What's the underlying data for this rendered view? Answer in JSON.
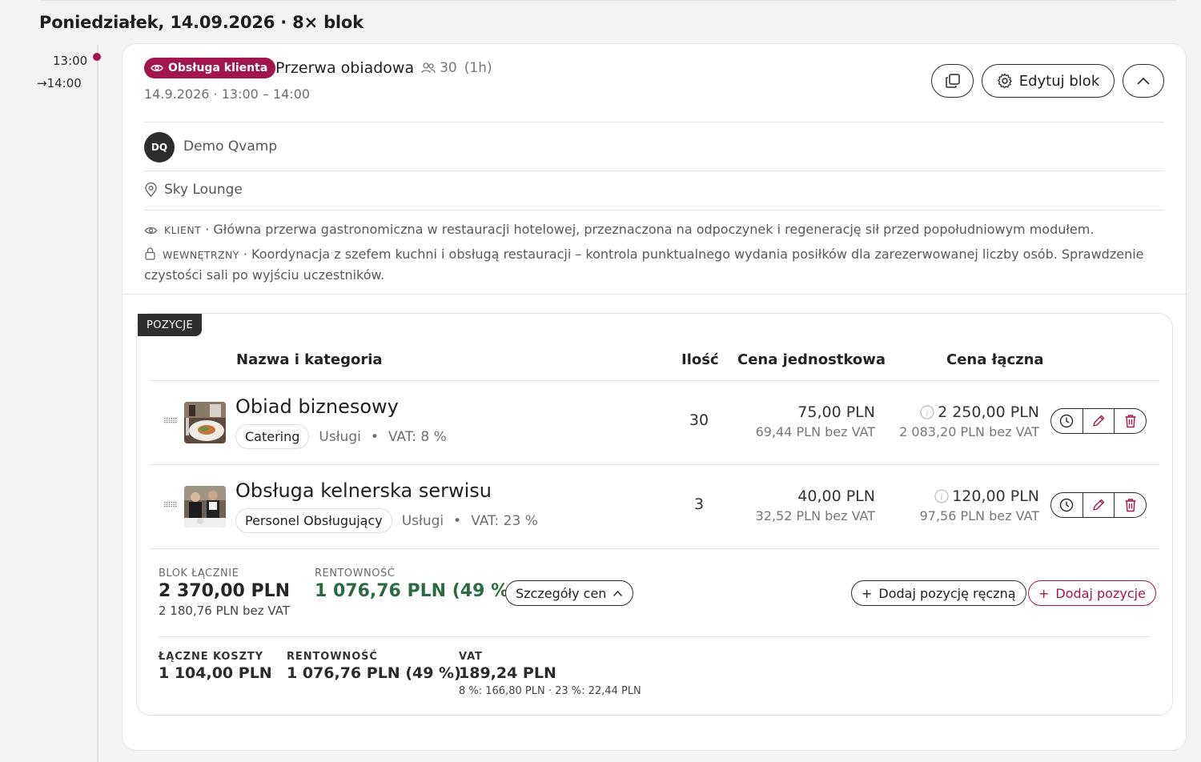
{
  "day_header": "Poniedziałek, 14.09.2026 · 8× blok",
  "timeline": {
    "start": "13:00",
    "end": "→14:00"
  },
  "block": {
    "badge": "Obsługa klienta",
    "title": "Przerwa obiadowa",
    "participants": "30",
    "duration": "(1h)",
    "datetime": "14.9.2026 · 13:00 – 14:00",
    "edit_label": "Edytuj blok",
    "client_initials": "DQ",
    "client_name": "Demo Qvamp",
    "venue": "Sky Lounge",
    "note_client_tag": "KLIENT",
    "note_client_text": " · Główna przerwa gastronomiczna w restauracji hotelowej, przeznaczona na odpoczynek i regenerację sił przed popołudniowym modułem.",
    "note_internal_tag": "WEWNĘTRZNY",
    "note_internal_text": " · Koordynacja z szefem kuchni i obsługą restauracji – kontrola punktualnego wydania posiłków dla zarezerwowanej liczby osób. Sprawdzenie czystości sali po wyjściu uczestników."
  },
  "positions": {
    "tag": "POZYCJE",
    "headers": {
      "name": "Nazwa i kategoria",
      "qty": "Ilość",
      "unit_price": "Cena jednostkowa",
      "total_price": "Cena łączna"
    },
    "items": [
      {
        "name": "Obiad biznesowy",
        "category": "Catering",
        "type": "Usługi",
        "vat": "VAT: 8 %",
        "qty": "30",
        "unit_gross": "75,00 PLN",
        "unit_net": "69,44 PLN bez VAT",
        "total_gross": "2 250,00 PLN",
        "total_net": "2 083,20 PLN bez VAT"
      },
      {
        "name": "Obsługa kelnerska serwisu",
        "category": "Personel Obsługujący",
        "type": "Usługi",
        "vat": "VAT: 23 %",
        "qty": "3",
        "unit_gross": "40,00 PLN",
        "unit_net": "32,52 PLN bez VAT",
        "total_gross": "120,00 PLN",
        "total_net": "97,56 PLN bez VAT"
      }
    ]
  },
  "summary": {
    "block_total_label": "BLOK ŁĄCZNIE",
    "block_total": "2 370,00 PLN",
    "block_total_net": "2 180,76 PLN bez VAT",
    "profit_label": "RENTOWNOŚĆ",
    "profit": "1 076,76 PLN (49 %)",
    "price_details": "Szczegóły cen",
    "add_manual": "Dodaj pozycję ręczną",
    "add_positions": "Dodaj pozycje",
    "costs_label": "ŁĄCZNE KOSZTY",
    "costs": "1 104,00 PLN",
    "profit2_label": "RENTOWNOŚĆ",
    "profit2": "1 076,76 PLN (49 %)",
    "vat_label": "VAT",
    "vat": "189,24 PLN",
    "vat_breakdown": "8 %: 166,80 PLN · 23 %: 22,44 PLN"
  },
  "colors": {
    "accent": "#a3154d",
    "profit": "#2b6b43"
  }
}
